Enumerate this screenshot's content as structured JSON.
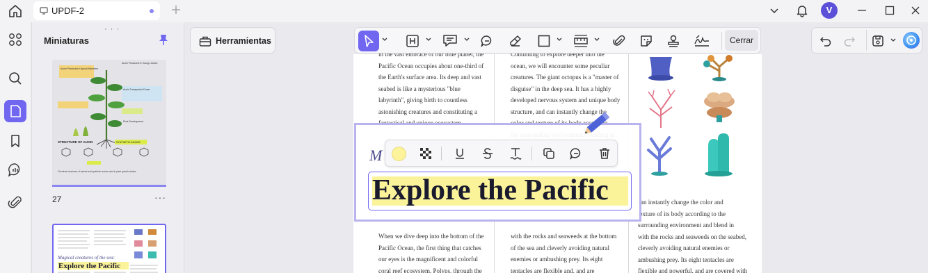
{
  "window": {
    "tab_title": "UPDF-2",
    "avatar_initial": "V"
  },
  "panel": {
    "title": "Miniaturas",
    "page_number": "27",
    "more_label": "···"
  },
  "tools_button": {
    "label": "Herramientas"
  },
  "toolbar": {
    "close_label": "Cerrar"
  },
  "colors": {
    "accent": "#7166f0",
    "highlight": "#fbf39a"
  },
  "document": {
    "heading": "Explore the Pacific",
    "initial_letter": "M",
    "col1_top": "in the vast embrace of our blue planet, the\nPacific Ocean occupies about one-third of\nthe Earth's surface area. Its deep and vast\nseabed is like a mysterious \"blue\nlabyrinth\", giving birth to countless\nastonishing creatures and constituting a\nfantastical and unique ecosystem.",
    "col2_top": "Continuing to explore deeper into the\nocean, we will encounter some peculiar\ncreatures. The giant octopus is a \"master of\ndisguise\" in the deep sea. It has a highly\ndeveloped nervous system and unique body\nstructure, and can instantly change the\ncolor and texture of its body according\nthe surrounding environment, blending in",
    "col1_bottom": "When we dive deep into the bottom of the\nPacific Ocean, the first thing that catches\nour eyes is the magnificent and colorful\ncoral reef ecosystem. Polyps, through the",
    "col2_bottom": "with the rocks and seaweeds at the bottom\nof the sea and cleverly avoiding natural\nenemies or ambushing prey. Its eight\ntentacles are flexible and, and are",
    "col3_bottom": "can instantly change the color and\ntexture of its body according to the\nsurrounding environment and blend in\nwith the rocks and seaweeds on the seabed,\ncleverly avoiding natural enemies or\nambushing prey. Its eight tentacles are\nflexible and powerful, and are covered with"
  },
  "thumb1": {
    "title": "STRUCTURE OF AUXIN",
    "tag": "SYNTHETIC AUXINS",
    "l1": "Auxin Produced in Apical Meristem",
    "l2": "Auxin Produced in Young Leaves",
    "l3": "Auxin Transported Down",
    "l4": "Root Development",
    "caption": "Chemical structures of natural and synthetic auxins used in plant growth studies"
  },
  "thumb2": {
    "subtitle": "Magical creatures of the sea:",
    "heading": "Explore the Pacific"
  }
}
